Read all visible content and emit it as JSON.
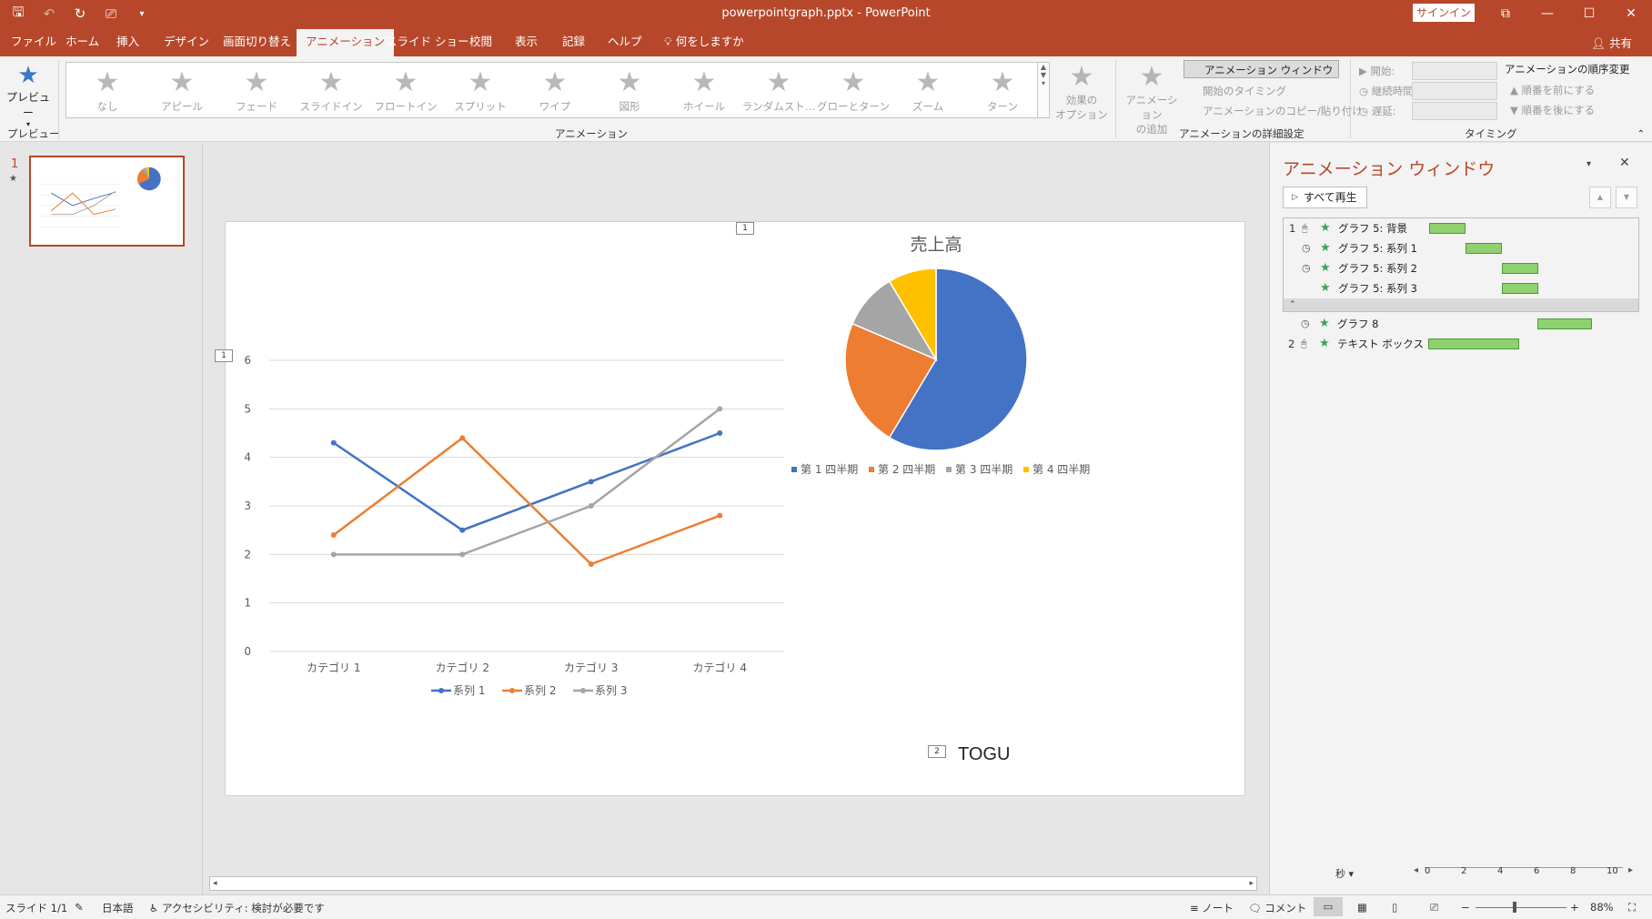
{
  "window": {
    "title": "powerpointgraph.pptx  -  PowerPoint",
    "signin": "サインイン",
    "share": "共有"
  },
  "tabs": [
    "ファイル",
    "ホーム",
    "挿入",
    "デザイン",
    "画面切り替え",
    "アニメーション",
    "スライド ショー",
    "校閲",
    "表示",
    "記録",
    "ヘルプ",
    "何をしますか"
  ],
  "ribbon": {
    "preview_label": "プレビュー",
    "preview_group": "プレビュー",
    "gallery": [
      "なし",
      "アピール",
      "フェード",
      "スライドイン",
      "フロートイン",
      "スプリット",
      "ワイプ",
      "図形",
      "ホイール",
      "ランダムスト…",
      "グローとターン",
      "ズーム",
      "ターン"
    ],
    "effect_options_1": "効果の",
    "effect_options_2": "オプション",
    "animation_group": "アニメーション",
    "add_animation_1": "アニメーション",
    "add_animation_2": "の追加",
    "animation_pane_btn": "アニメーション ウィンドウ",
    "trigger": "開始のタイミング",
    "copy_paste": "アニメーションのコピー/貼り付け",
    "advanced_group": "アニメーションの詳細設定",
    "start": "開始:",
    "duration": "継続時間:",
    "delay": "遅延:",
    "timing_group": "タイミング",
    "reorder_title": "アニメーションの順序変更",
    "move_earlier": "順番を前にする",
    "move_later": "順番を後にする"
  },
  "thumbnail": {
    "number": "1"
  },
  "slide": {
    "tag_top": "1",
    "tag_left": "1",
    "tag_text": "2",
    "textbox": "TOGU"
  },
  "chart_data": [
    {
      "type": "line",
      "categories": [
        "カテゴリ 1",
        "カテゴリ 2",
        "カテゴリ 3",
        "カテゴリ 4"
      ],
      "series": [
        {
          "name": "系列 1",
          "values": [
            4.3,
            2.5,
            3.5,
            4.5
          ],
          "color": "#4472c4"
        },
        {
          "name": "系列 2",
          "values": [
            2.4,
            4.4,
            1.8,
            2.8
          ],
          "color": "#ed7d31"
        },
        {
          "name": "系列 3",
          "values": [
            2,
            2,
            3,
            5
          ],
          "color": "#a5a5a5"
        }
      ],
      "ylim": [
        0,
        6
      ],
      "yticks": [
        0,
        1,
        2,
        3,
        4,
        5,
        6
      ],
      "grid": true,
      "legend": "bottom"
    },
    {
      "type": "pie",
      "title": "売上高",
      "labels": [
        "第 1 四半期",
        "第 2 四半期",
        "第 3 四半期",
        "第 4 四半期"
      ],
      "values": [
        8.2,
        3.2,
        1.4,
        1.2
      ],
      "colors": [
        "#4472c4",
        "#ed7d31",
        "#a5a5a5",
        "#ffc000"
      ],
      "legend": "bottom"
    }
  ],
  "anim_pane": {
    "title": "アニメーション ウィンドウ",
    "play_all": "すべて再生",
    "items": [
      {
        "num": "1",
        "label": "グラフ 5: 背景"
      },
      {
        "num": "",
        "label": "グラフ 5: 系列 1"
      },
      {
        "num": "",
        "label": "グラフ 5: 系列 2"
      },
      {
        "num": "",
        "label": "グラフ 5: 系列 3"
      },
      {
        "num": "",
        "label": "グラフ 8"
      },
      {
        "num": "2",
        "label": "テキスト ボックス 1..."
      }
    ],
    "seconds": "秒",
    "timeline": [
      "0",
      "2",
      "4",
      "6",
      "8",
      "10"
    ]
  },
  "status": {
    "slide": "スライド 1/1",
    "language": "日本語",
    "accessibility": "アクセシビリティ: 検討が必要です",
    "notes": "ノート",
    "comments": "コメント",
    "zoom": "88%"
  }
}
